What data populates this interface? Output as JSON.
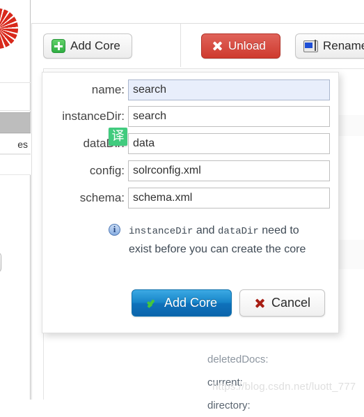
{
  "app": {
    "logo_icon": "solr-logo-sunburst",
    "watermark": "https://blog.csdn.net/luott_777"
  },
  "sidebar": {
    "items": [
      {
        "label": "",
        "state": "selected"
      },
      {
        "label": "es",
        "state": "normal"
      },
      {
        "label": "",
        "state": "link"
      }
    ],
    "core_selector": {
      "value": "",
      "caret_icon": "chevron-down-icon"
    }
  },
  "toolbar": {
    "add_core": {
      "label": "Add Core",
      "icon": "plus-icon"
    },
    "unload": {
      "label": "Unload",
      "icon": "x-icon"
    },
    "rename": {
      "label": "Rename",
      "icon": "rename-icon"
    }
  },
  "background": {
    "rows": [
      "deletedDocs:",
      "current:",
      "directory:"
    ]
  },
  "dialog": {
    "fields": [
      {
        "id": "name",
        "label": "name:",
        "value": "search",
        "focused": true
      },
      {
        "id": "instanceDir",
        "label": "instanceDir:",
        "value": "search",
        "focused": false
      },
      {
        "id": "dataDir",
        "label": "dataDir:",
        "value": "data",
        "focused": false
      },
      {
        "id": "config",
        "label": "config:",
        "value": "solrconfig.xml",
        "focused": false
      },
      {
        "id": "schema",
        "label": "schema:",
        "value": "schema.xml",
        "focused": false
      }
    ],
    "note": {
      "icon": "info-icon",
      "code_1": "instanceDir",
      "mid": " and ",
      "code_2": "dataDir",
      "tail": " need to exist before you can create the core"
    },
    "actions": {
      "submit": {
        "label": "Add Core",
        "icon": "check-icon"
      },
      "cancel": {
        "label": "Cancel",
        "icon": "x-icon"
      }
    }
  },
  "overlay": {
    "translate_badge": "译"
  },
  "colors": {
    "accent_blue": "#1784c8",
    "danger_red": "#ce3a2e",
    "success_green": "#2fae42",
    "focus_field_bg": "#e8eefb",
    "translate_green": "#41cb7e"
  }
}
